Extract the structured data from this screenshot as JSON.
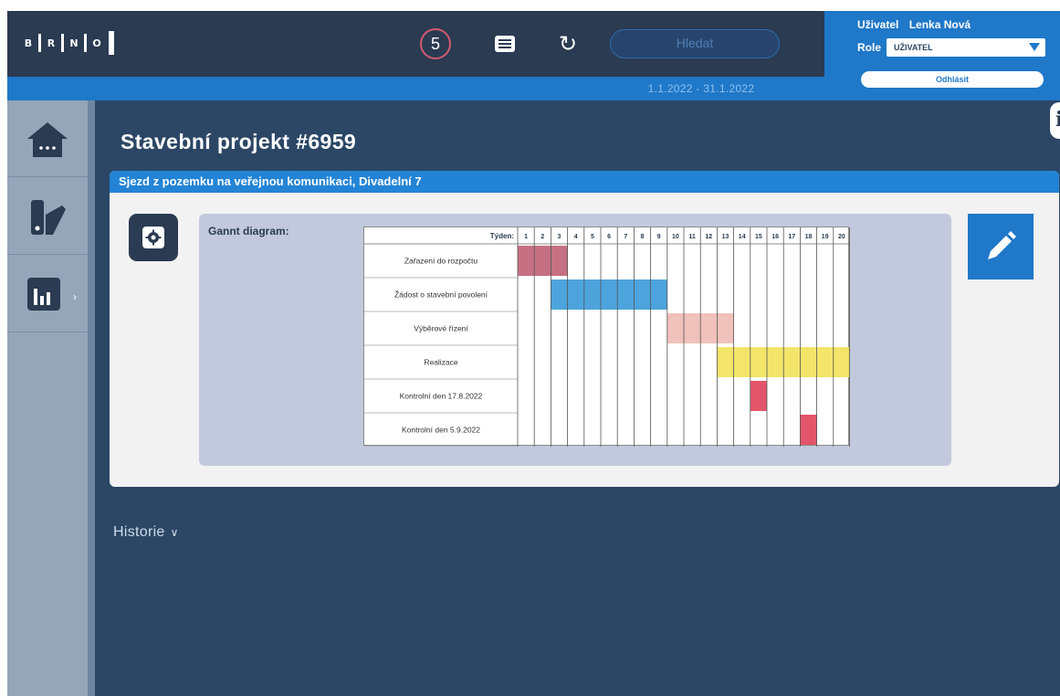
{
  "logo": {
    "letters": [
      "B",
      "R",
      "N",
      "O"
    ]
  },
  "header": {
    "notification_count": "5",
    "search_label": "Hledat",
    "date_range": "1.1.2022 - 31.1.2022",
    "user_label": "Uživatel",
    "user_name": "Lenka Nová",
    "role_label": "Role",
    "role_value": "UŽIVATEL",
    "logout_label": "Odhlásit"
  },
  "sidebar": {
    "items": [
      {
        "name": "home",
        "icon": "home-icon"
      },
      {
        "name": "documents",
        "icon": "documents-icon"
      },
      {
        "name": "statistics",
        "icon": "bar-chart-icon"
      }
    ]
  },
  "page": {
    "title": "Stavební projekt #6959",
    "card_header": "Sjezd z pozemku na veřejnou komunikaci, Divadelní 7",
    "gantt_label": "Gannt diagram:",
    "history_label": "Historie"
  },
  "gantt": {
    "week_header": "Týden:",
    "weeks": [
      1,
      2,
      3,
      4,
      5,
      6,
      7,
      8,
      9,
      10,
      11,
      12,
      13,
      14,
      15,
      16,
      17,
      18,
      19,
      20
    ],
    "tasks": [
      {
        "name": "Zařazení do rozpočtu",
        "start": 1,
        "end": 3,
        "color": "#c06076"
      },
      {
        "name": "Žádost o stavební povolení",
        "start": 3,
        "end": 9,
        "color": "#3a9ad8"
      },
      {
        "name": "Výběrové řízení",
        "start": 10,
        "end": 13,
        "color": "#efbab4"
      },
      {
        "name": "Realizace",
        "start": 13,
        "end": 20,
        "color": "#f2e25a"
      },
      {
        "name": "Kontrolní den 17.8.2022",
        "start": 15,
        "end": 15,
        "color": "#e0435a"
      },
      {
        "name": "Kontrolní den 5.9.2022",
        "start": 18,
        "end": 18,
        "color": "#e0435a"
      }
    ]
  }
}
